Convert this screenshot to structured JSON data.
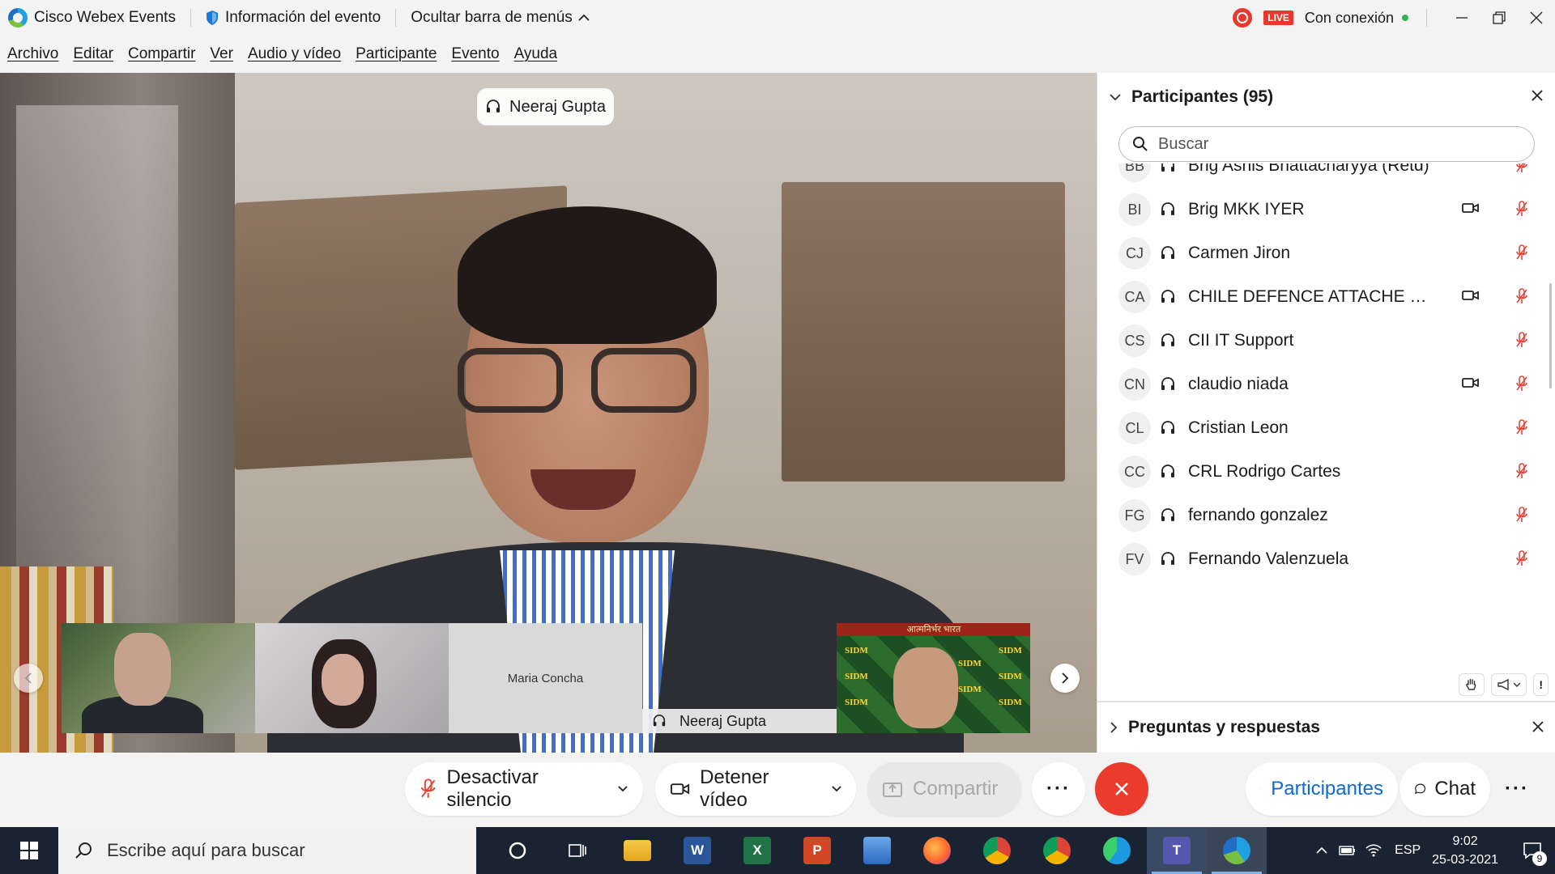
{
  "titlebar": {
    "app_name": "Cisco Webex Events",
    "event_info": "Información del evento",
    "hide_menu": "Ocultar barra de menús",
    "live": "LIVE",
    "connection": "Con conexión"
  },
  "menu": [
    "Archivo",
    "Editar",
    "Compartir",
    "Ver",
    "Audio y vídeo",
    "Participante",
    "Evento",
    "Ayuda"
  ],
  "stage": {
    "active_speaker": "Neeraj Gupta",
    "thumbnails": [
      {
        "name": ""
      },
      {
        "name": ""
      },
      {
        "name": "Maria Concha"
      },
      {
        "name": "Neeraj Gupta"
      },
      {
        "name": ""
      }
    ],
    "sidm_banner_text": "आत्मनिर्भर भारत",
    "sidm_logo_text": "SIDM"
  },
  "panel": {
    "title": "Participantes (95)",
    "search_placeholder": "Buscar",
    "participants": [
      {
        "initials": "BB",
        "name": "Brig Ashis Bhattacharyya (Retd)",
        "video": false
      },
      {
        "initials": "BI",
        "name": "Brig MKK IYER",
        "video": true
      },
      {
        "initials": "CJ",
        "name": "Carmen Jiron",
        "video": false
      },
      {
        "initials": "CA",
        "name": "CHILE DEFENCE ATTACHE DA...",
        "video": true
      },
      {
        "initials": "CS",
        "name": "CII IT Support",
        "video": false
      },
      {
        "initials": "CN",
        "name": "claudio niada",
        "video": true
      },
      {
        "initials": "CL",
        "name": "Cristian Leon",
        "video": false
      },
      {
        "initials": "CC",
        "name": "CRL Rodrigo Cartes",
        "video": false
      },
      {
        "initials": "FG",
        "name": "fernando gonzalez",
        "video": false
      },
      {
        "initials": "FV",
        "name": "Fernando Valenzuela",
        "video": false
      }
    ],
    "qa_title": "Preguntas y respuestas"
  },
  "controls": {
    "mute": "Desactivar silencio",
    "video": "Detener vídeo",
    "share": "Compartir",
    "participants": "Participantes",
    "chat": "Chat"
  },
  "taskbar": {
    "search_placeholder": "Escribe aquí para buscar",
    "lang": "ESP",
    "time": "9:02",
    "date": "25-03-2021",
    "notifications": "9"
  },
  "colors": {
    "accent_blue": "#0b6bd3",
    "leave_red": "#ea3b2c",
    "mute_red": "#e0463a",
    "live_red": "#e8372b",
    "connected_green": "#2fb34a"
  }
}
